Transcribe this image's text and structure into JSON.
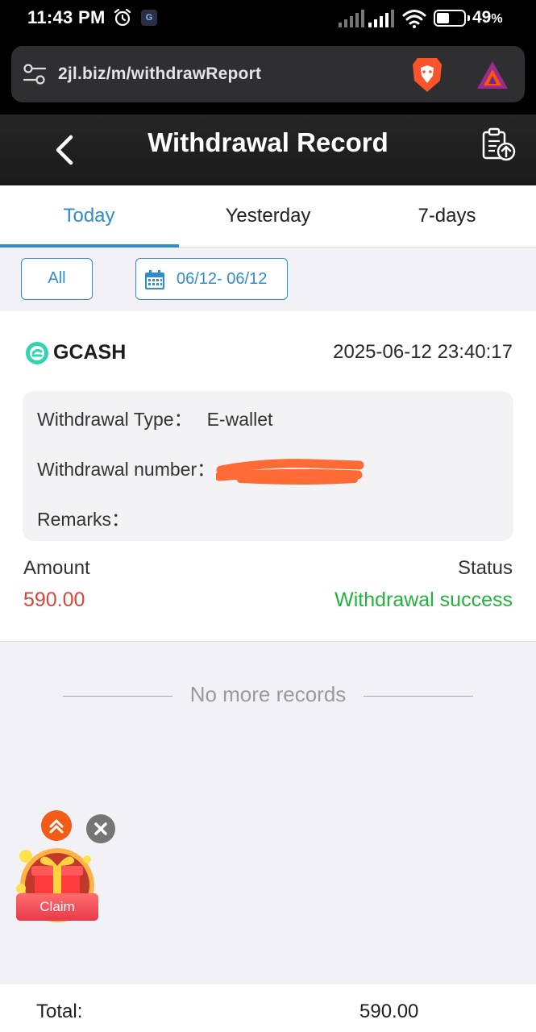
{
  "status_bar": {
    "time": "11:43 PM",
    "battery_percent": "49",
    "battery_suffix": "%",
    "battery_level": 0.49,
    "icons": [
      "alarm-icon",
      "g-app-icon",
      "signal-icon",
      "signal-icon",
      "wifi-icon",
      "battery-icon"
    ]
  },
  "browser": {
    "url": "2jl.biz/m/withdrawReport",
    "icons": [
      "site-settings-icon",
      "brave-shields-icon",
      "brave-rewards-icon"
    ]
  },
  "header": {
    "title": "Withdrawal Record",
    "icons": [
      "back-arrow-icon",
      "clipboard-upload-icon"
    ]
  },
  "tabs": [
    {
      "label": "Today",
      "active": true
    },
    {
      "label": "Yesterday",
      "active": false
    },
    {
      "label": "7-days",
      "active": false
    }
  ],
  "filters": {
    "type_label": "All",
    "date_range": "06/12- 06/12",
    "icon": "calendar-icon"
  },
  "record": {
    "channel": "GCASH",
    "datetime": "2025-06-12 23:40:17",
    "withdrawal_type_label": "Withdrawal Type：",
    "withdrawal_type_value": "E-wallet",
    "withdrawal_number_label": "Withdrawal number：",
    "withdrawal_number_value": "",
    "remarks_label": "Remarks：",
    "remarks_value": "",
    "amount_label": "Amount",
    "amount_value": "590.00",
    "status_label": "Status",
    "status_value": "Withdrawal success"
  },
  "list_end": {
    "text": "No more records"
  },
  "floating_widget": {
    "claim_label": "Claim"
  },
  "footer": {
    "total_label": "Total:",
    "total_value": "590.00"
  },
  "colors": {
    "accent": "#2f8ccd",
    "amount": "#d9453a",
    "success": "#22b33c",
    "header_bg": "#1f1f1f"
  }
}
